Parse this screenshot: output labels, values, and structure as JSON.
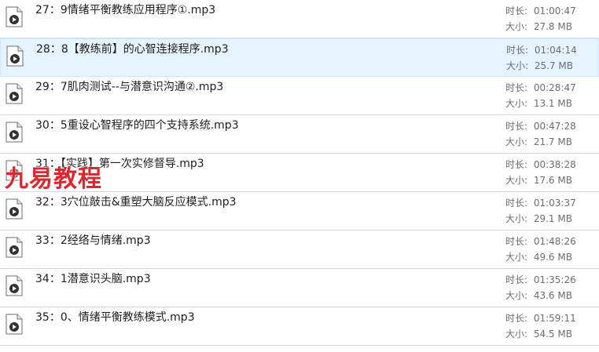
{
  "files": [
    {
      "name": "27：9情绪平衡教练应用程序①.mp3",
      "duration_label": "时长:",
      "duration": "01:00:47",
      "size_label": "大小:",
      "size": "27.8 MB"
    },
    {
      "name": "28：8【教练前】的心智连接程序.mp3",
      "duration_label": "时长:",
      "duration": "01:04:14",
      "size_label": "大小:",
      "size": "25.7 MB"
    },
    {
      "name": "29：7肌肉测试--与潜意识沟通②.mp3",
      "duration_label": "时长:",
      "duration": "00:28:47",
      "size_label": "大小:",
      "size": "13.1 MB"
    },
    {
      "name": "30：5重设心智程序的四个支持系统.mp3",
      "duration_label": "时长:",
      "duration": "00:47:28",
      "size_label": "大小:",
      "size": "21.7 MB"
    },
    {
      "name": "31：【实践】第一次实修督导.mp3",
      "duration_label": "时长:",
      "duration": "00:38:28",
      "size_label": "大小:",
      "size": "17.6 MB"
    },
    {
      "name": "32：3穴位敲击&重塑大脑反应模式.mp3",
      "duration_label": "时长:",
      "duration": "01:03:37",
      "size_label": "大小:",
      "size": "29.1 MB"
    },
    {
      "name": "33：2经络与情绪.mp3",
      "duration_label": "时长:",
      "duration": "01:48:26",
      "size_label": "大小:",
      "size": "49.6 MB"
    },
    {
      "name": "34：1潜意识头脑.mp3",
      "duration_label": "时长:",
      "duration": "01:35:26",
      "size_label": "大小:",
      "size": "43.6 MB"
    },
    {
      "name": "35：0、情绪平衡教练模式.mp3",
      "duration_label": "时长:",
      "duration": "01:59:11",
      "size_label": "大小:",
      "size": "54.5 MB"
    }
  ],
  "watermark": "九易教程",
  "colors": {
    "selected_bg": "#e5f3ff",
    "watermark": "#e0252f",
    "meta_text": "#6d6d6d"
  },
  "icons": {
    "file": "audio-file-icon"
  }
}
